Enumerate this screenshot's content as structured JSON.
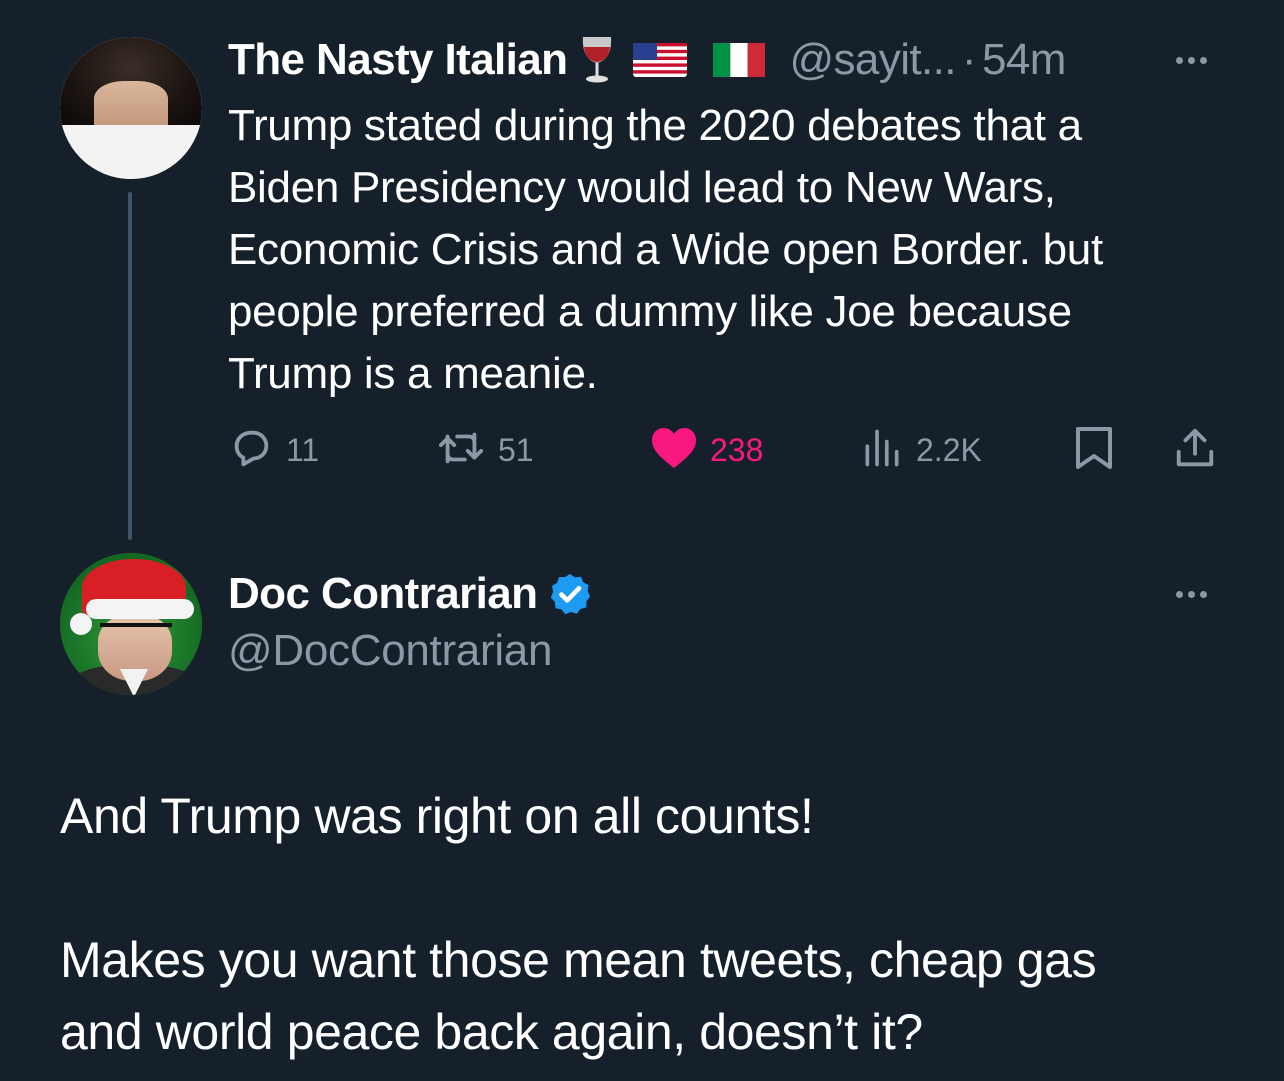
{
  "parent_tweet": {
    "author_name": "The Nasty Italian",
    "author_emojis": [
      "wine-glass-icon",
      "us-flag-icon",
      "italy-flag-icon"
    ],
    "handle": "@sayit...",
    "separator": "·",
    "time": "54m",
    "text_lines": [
      "Trump stated during the 2020 debates that a",
      "Biden Presidency would lead to New Wars,",
      "Economic Crisis and a Wide open Border. but",
      "people preferred a dummy like Joe because",
      "Trump is a meanie."
    ],
    "actions": {
      "replies": "11",
      "reposts": "51",
      "likes": "238",
      "views": "2.2K"
    }
  },
  "reply_tweet": {
    "author_name": "Doc Contrarian",
    "verified": true,
    "handle": "@DocContrarian",
    "paragraphs": [
      [
        "And Trump was right on all counts!"
      ],
      [
        "Makes you want those mean tweets, cheap gas",
        "and world peace back again, doesn’t it?"
      ]
    ]
  },
  "colors": {
    "background": "#15202b",
    "text_primary": "#ffffff",
    "text_secondary": "#8b98a5",
    "like_active": "#f91880",
    "verified_badge": "#1d9bf0",
    "thread_line": "#425466"
  }
}
